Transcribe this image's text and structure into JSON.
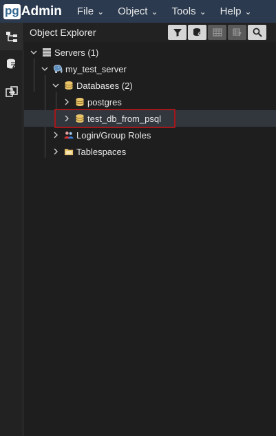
{
  "app": {
    "logo_pg": "pg",
    "logo_admin": "Admin"
  },
  "menu": [
    {
      "label": "File"
    },
    {
      "label": "Object"
    },
    {
      "label": "Tools"
    },
    {
      "label": "Help"
    }
  ],
  "panel": {
    "title": "Object Explorer"
  },
  "tree": {
    "servers": "Servers (1)",
    "server": "my_test_server",
    "databases": "Databases (2)",
    "db1": "postgres",
    "db2": "test_db_from_psql",
    "roles": "Login/Group Roles",
    "tablespaces": "Tablespaces"
  },
  "colors": {
    "topbar": "#2b3a4f",
    "highlight": "#a3171a",
    "db_icon": "#e8c36a"
  }
}
